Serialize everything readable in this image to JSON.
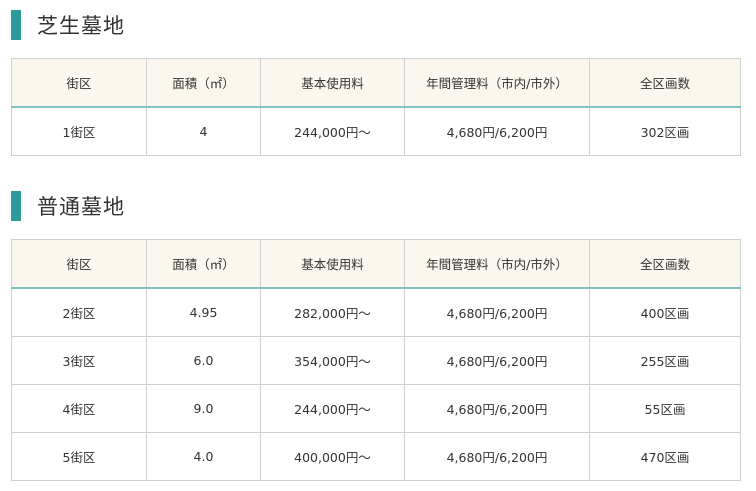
{
  "colors": {
    "accent": "#2a9a9a",
    "header_bg": "#fbf7ee",
    "header_rule": "#7cc3c3"
  },
  "sections": [
    {
      "title": "芝生墓地",
      "headers": [
        "街区",
        "面積（㎡）",
        "基本使用料",
        "年間管理料（市内/市外）",
        "全区画数"
      ],
      "rows": [
        [
          "1街区",
          "4",
          "244,000円〜",
          "4,680円/6,200円",
          "302区画"
        ]
      ]
    },
    {
      "title": "普通墓地",
      "headers": [
        "街区",
        "面積（㎡）",
        "基本使用料",
        "年間管理料（市内/市外）",
        "全区画数"
      ],
      "rows": [
        [
          "2街区",
          "4.95",
          "282,000円〜",
          "4,680円/6,200円",
          "400区画"
        ],
        [
          "3街区",
          "6.0",
          "354,000円〜",
          "4,680円/6,200円",
          "255区画"
        ],
        [
          "4街区",
          "9.0",
          "244,000円〜",
          "4,680円/6,200円",
          "55区画"
        ],
        [
          "5街区",
          "4.0",
          "400,000円〜",
          "4,680円/6,200円",
          "470区画"
        ]
      ]
    }
  ]
}
